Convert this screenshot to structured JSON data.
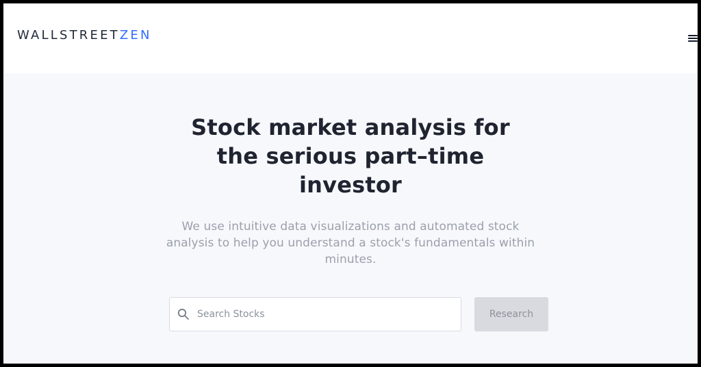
{
  "header": {
    "logo_main": "WALLSTREET",
    "logo_accent": "ZEN",
    "menu_icon": "hamburger-menu-icon"
  },
  "hero": {
    "title_line1": "Stock market analysis for",
    "title_line2": "the serious part–time",
    "title_line3": "investor",
    "subtitle_line1": "We use intuitive data visualizations and automated stock",
    "subtitle_line2": "analysis to help you understand a stock's fundamentals within",
    "subtitle_line3": "minutes."
  },
  "search": {
    "placeholder": "Search Stocks",
    "value": "",
    "icon": "search-icon",
    "button_label": "Research"
  },
  "colors": {
    "accent": "#2f6bff",
    "title_text": "#1f2430",
    "subtitle_text": "#9aa0ab",
    "hero_background": "#f7f8fc",
    "button_background": "#d9dadf"
  }
}
